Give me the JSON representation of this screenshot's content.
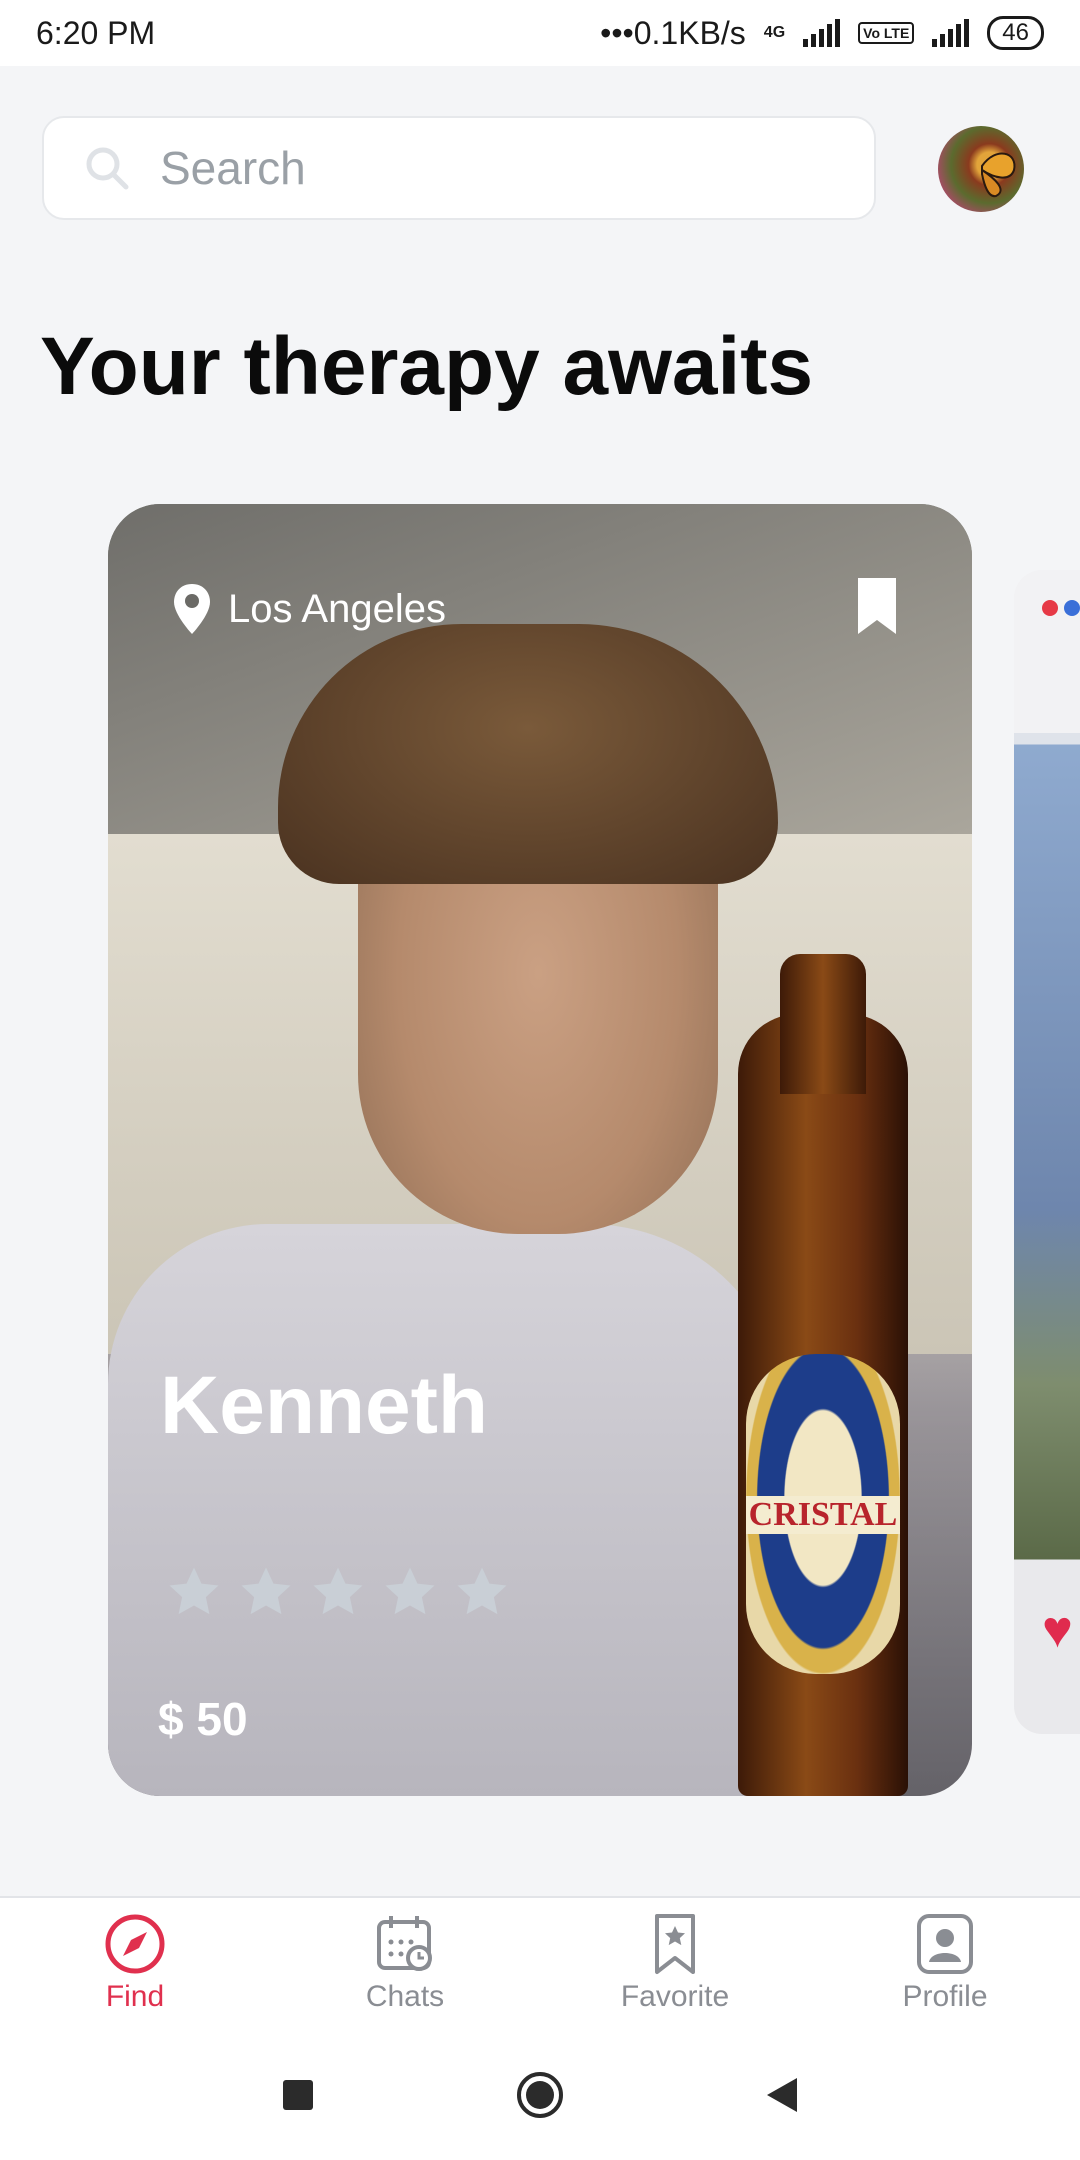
{
  "status_bar": {
    "time": "6:20 PM",
    "network_speed": "•••0.1KB/s",
    "network_type": "4G",
    "volte": "Vo LTE",
    "battery": "46"
  },
  "search": {
    "placeholder": "Search"
  },
  "headline": "Your therapy awaits",
  "card": {
    "location": "Los Angeles",
    "name": "Kenneth",
    "rating": 0,
    "rating_max": 5,
    "price": "$ 50",
    "bottle_label": "CRISTAL"
  },
  "tabs": [
    {
      "label": "Find",
      "icon": "compass-icon",
      "active": true
    },
    {
      "label": "Chats",
      "icon": "calendar-clock-icon",
      "active": false
    },
    {
      "label": "Favorite",
      "icon": "bookmark-star-icon",
      "active": false
    },
    {
      "label": "Profile",
      "icon": "profile-card-icon",
      "active": false
    }
  ],
  "colors": {
    "accent": "#e0304e",
    "inactive": "#8a8d93",
    "background": "#f4f5f7"
  }
}
